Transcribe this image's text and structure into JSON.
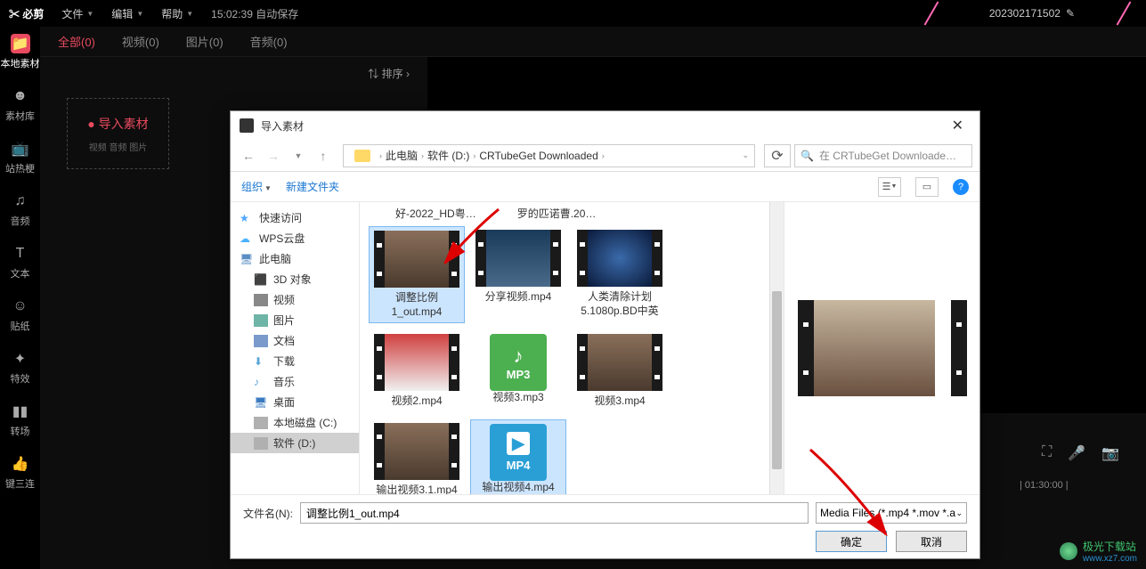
{
  "topbar": {
    "logo": "必剪",
    "menu_file": "文件",
    "menu_edit": "编辑",
    "menu_help": "帮助",
    "autosave": "15:02:39 自动保存",
    "project_name": "202302171502"
  },
  "sidebar": {
    "items": [
      {
        "label": "本地素材"
      },
      {
        "label": "素材库"
      },
      {
        "label": "站热梗"
      },
      {
        "label": "音频"
      },
      {
        "label": "文本"
      },
      {
        "label": "贴纸"
      },
      {
        "label": "特效"
      },
      {
        "label": "转场"
      },
      {
        "label": "键三连"
      }
    ]
  },
  "tabs": {
    "all": "全部(0)",
    "video": "视频(0)",
    "image": "图片(0)",
    "audio": "音频(0)",
    "sort": "排序"
  },
  "import_zone": {
    "title": "导入素材",
    "sub": "视频 音频 图片"
  },
  "timeline": {
    "marker": "01:30:00"
  },
  "dialog": {
    "title": "导入素材",
    "breadcrumb": {
      "pc": "此电脑",
      "drive": "软件 (D:)",
      "folder": "CRTubeGet Downloaded"
    },
    "search_placeholder": "在 CRTubeGet Downloade…",
    "toolbar": {
      "organize": "组织",
      "newfolder": "新建文件夹"
    },
    "tree": {
      "quick": "快速访问",
      "wps": "WPS云盘",
      "pc": "此电脑",
      "obj3d": "3D 对象",
      "video": "视频",
      "image": "图片",
      "doc": "文档",
      "download": "下载",
      "music": "音乐",
      "desktop": "桌面",
      "drive_c": "本地磁盘 (C:)",
      "drive_d": "软件 (D:)"
    },
    "toprow": {
      "a": "好-2022_HD粤…",
      "b": "罗的匹诺曹.20…"
    },
    "files": [
      {
        "name": "调整比例1_out.mp4",
        "type": "video",
        "thumb": "brown",
        "selected": true
      },
      {
        "name": "分享视频.mp4",
        "type": "video",
        "thumb": "sky"
      },
      {
        "name": "人类清除计划5.1080p.BD中英",
        "type": "video",
        "thumb": "earth"
      },
      {
        "name": "视频2.mp4",
        "type": "video",
        "thumb": "red"
      },
      {
        "name": "视频3.mp3",
        "type": "mp3"
      },
      {
        "name": "视频3.mp4",
        "type": "video",
        "thumb": "brown"
      },
      {
        "name": "输出视频3.1.mp4",
        "type": "video",
        "thumb": "brown"
      },
      {
        "name": "输出视频4.mp4",
        "type": "mp4",
        "selected": true
      }
    ],
    "mp3_label": "MP3",
    "mp4_label": "MP4",
    "footer": {
      "filename_label": "文件名(N):",
      "filename_value": "调整比例1_out.mp4",
      "filetype": "Media Files (*.mp4 *.mov *.a",
      "ok": "确定",
      "cancel": "取消"
    }
  },
  "watermark": {
    "name": "极光下载站",
    "url": "www.xz7.com"
  }
}
